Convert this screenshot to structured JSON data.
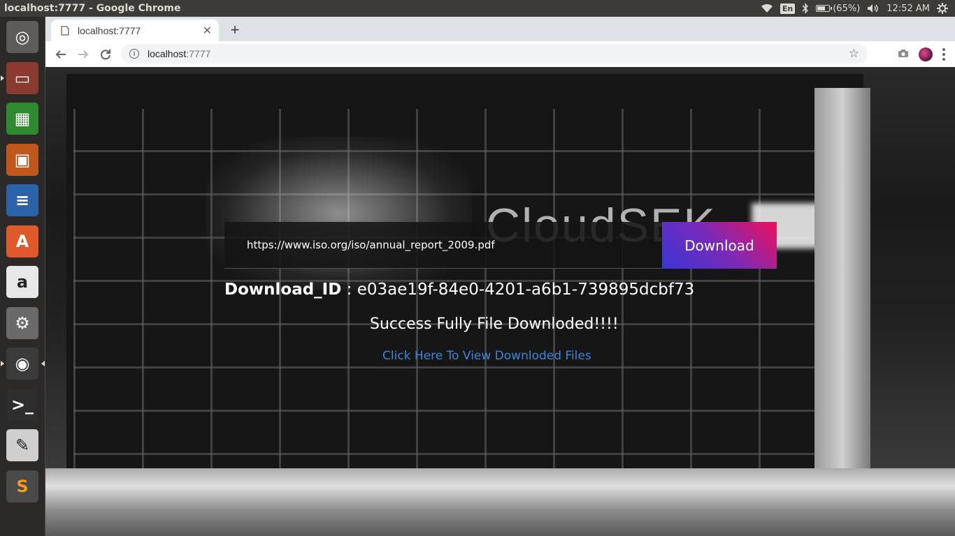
{
  "os": {
    "window_title": "localhost:7777 - Google Chrome",
    "tray": {
      "keyboard_layout": "En",
      "battery_percent_label": "(65%)",
      "battery_level": 0.65,
      "time": "12:52 AM"
    },
    "launcher": [
      {
        "name": "ubuntu-dash",
        "icon": "ubuntu-logo-icon",
        "color": "#5e5c58"
      },
      {
        "name": "files",
        "icon": "file-cabinet-icon",
        "color": "#8a3a2e"
      },
      {
        "name": "libreoffice-calc",
        "icon": "spreadsheet-icon",
        "color": "#2f8a2f"
      },
      {
        "name": "libreoffice-impress",
        "icon": "presentation-icon",
        "color": "#c0581e"
      },
      {
        "name": "libreoffice-writer",
        "icon": "document-icon",
        "color": "#2c63a8"
      },
      {
        "name": "software-center",
        "icon": "shopping-bag-icon",
        "color": "#e0592a"
      },
      {
        "name": "amazon",
        "icon": "amazon-icon",
        "color": "#e8e8e8"
      },
      {
        "name": "system-settings",
        "icon": "settings-wrench-icon",
        "color": "#6a6a6a"
      },
      {
        "name": "google-chrome",
        "icon": "chrome-icon",
        "color": "#3b3b3b"
      },
      {
        "name": "terminal",
        "icon": "terminal-icon",
        "color": "#2d2d2d"
      },
      {
        "name": "text-editor",
        "icon": "text-editor-icon",
        "color": "#cfcfcf"
      },
      {
        "name": "sublime-text",
        "icon": "sublime-icon",
        "color": "#4a4a4a"
      }
    ]
  },
  "browser": {
    "tab_title": "localhost:7777",
    "url_host": "localhost",
    "url_port": ":7777"
  },
  "page": {
    "url_input_value": "https://www.iso.org/iso/annual_report_2009.pdf",
    "download_button": "Download",
    "download_id_label": "Download_ID",
    "download_id_sep": " : ",
    "download_id_value": "e03ae19f-84e0-4201-a6b1-739895dcbf73",
    "success_message": "Success Fully File Downloded!!!!",
    "view_link": "Click Here To View Downloded Files",
    "background_sign_text": "CloudSEK",
    "accent_link_color": "#3f86d8"
  }
}
